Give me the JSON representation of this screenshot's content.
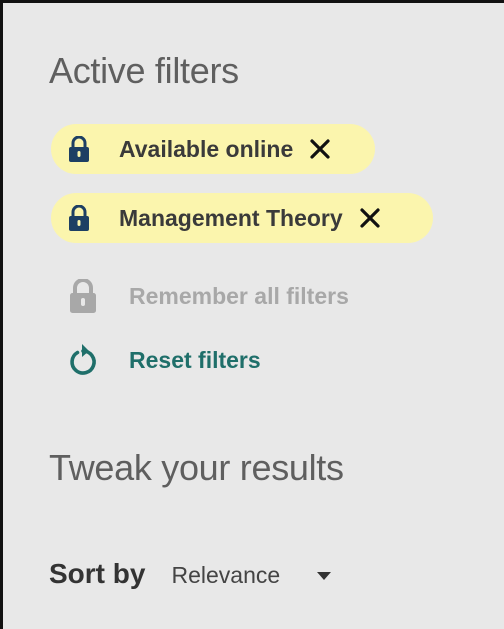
{
  "active_filters": {
    "title": "Active filters",
    "chips": [
      {
        "label": "Available online",
        "lock_icon": "lock-icon",
        "close_icon": "close-icon"
      },
      {
        "label": "Management Theory",
        "lock_icon": "lock-icon",
        "close_icon": "close-icon"
      }
    ],
    "remember_label": "Remember all filters",
    "reset_label": "Reset filters"
  },
  "tweak": {
    "title": "Tweak your results",
    "sort_label": "Sort by",
    "sort_value": "Relevance"
  },
  "colors": {
    "panel_bg": "#e8e8e8",
    "chip_bg": "#fbf5ad",
    "lock_active": "#1d3f63",
    "lock_disabled": "#a8a8a8",
    "reset_accent": "#1f6f6a",
    "title_text": "#5f5f5f"
  }
}
